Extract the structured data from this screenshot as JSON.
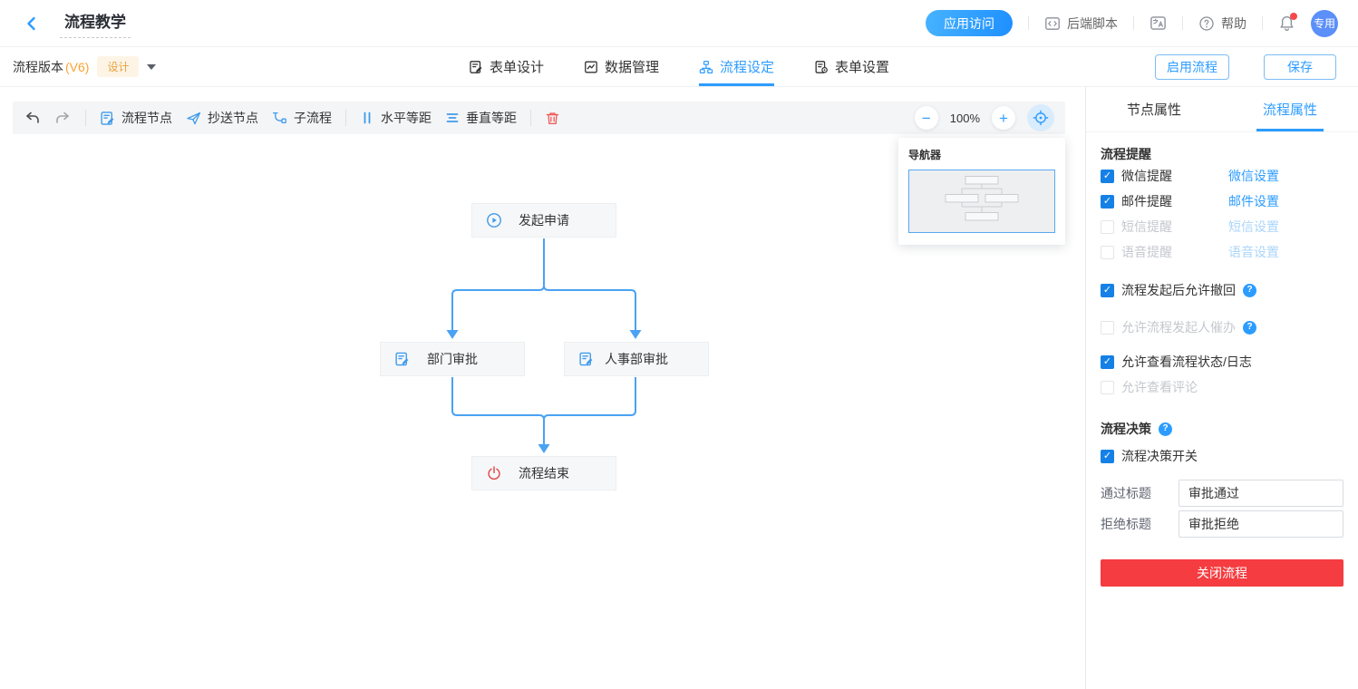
{
  "colors": {
    "accent": "#2D9CFF",
    "checkbox": "#1581E6",
    "danger": "#F53C40",
    "orange": "#FFA12F",
    "edge": "#4AA2F3"
  },
  "header": {
    "title": "流程教学",
    "app_access": "应用访问",
    "backend_script": "后端脚本",
    "help": "帮助",
    "avatar": "专用"
  },
  "subheader": {
    "version_label": "流程版本",
    "version": "(V6)",
    "design_badge": "设计",
    "tabs": [
      {
        "label": "表单设计"
      },
      {
        "label": "数据管理"
      },
      {
        "label": "流程设定"
      },
      {
        "label": "表单设置"
      }
    ],
    "enable_button": "启用流程",
    "save_button": "保存"
  },
  "toolbar": {
    "items": [
      "流程节点",
      "抄送节点",
      "子流程",
      "水平等距",
      "垂直等距"
    ],
    "zoom_out_label": "−",
    "zoom_level": "100%",
    "zoom_in_label": "+"
  },
  "navigator": {
    "title": "导航器"
  },
  "flow": {
    "nodes": [
      {
        "label": "发起申请"
      },
      {
        "label": "部门审批"
      },
      {
        "label": "人事部审批"
      },
      {
        "label": "流程结束"
      }
    ]
  },
  "panel": {
    "tabs": [
      "节点属性",
      "流程属性"
    ],
    "remind_title": "流程提醒",
    "remind_rows": [
      {
        "label": "微信提醒",
        "link": "微信设置",
        "checked": true,
        "disabled": false
      },
      {
        "label": "邮件提醒",
        "link": "邮件设置",
        "checked": true,
        "disabled": false
      },
      {
        "label": "短信提醒",
        "link": "短信设置",
        "checked": false,
        "disabled": true
      },
      {
        "label": "语音提醒",
        "link": "语音设置",
        "checked": false,
        "disabled": true
      }
    ],
    "options": [
      {
        "label": "流程发起后允许撤回",
        "checked": true,
        "help": true,
        "disabled": false
      },
      {
        "label": "允许流程发起人催办",
        "checked": false,
        "help": true,
        "disabled": true
      },
      {
        "label": "允许查看流程状态/日志",
        "checked": true,
        "help": false,
        "disabled": false
      },
      {
        "label": "允许查看评论",
        "checked": false,
        "help": false,
        "disabled": true
      }
    ],
    "decision_title": "流程决策",
    "decision_switch": "流程决策开关",
    "pass_label": "通过标题",
    "pass_value": "审批通过",
    "reject_label": "拒绝标题",
    "reject_value": "审批拒绝",
    "close_button": "关闭流程"
  }
}
